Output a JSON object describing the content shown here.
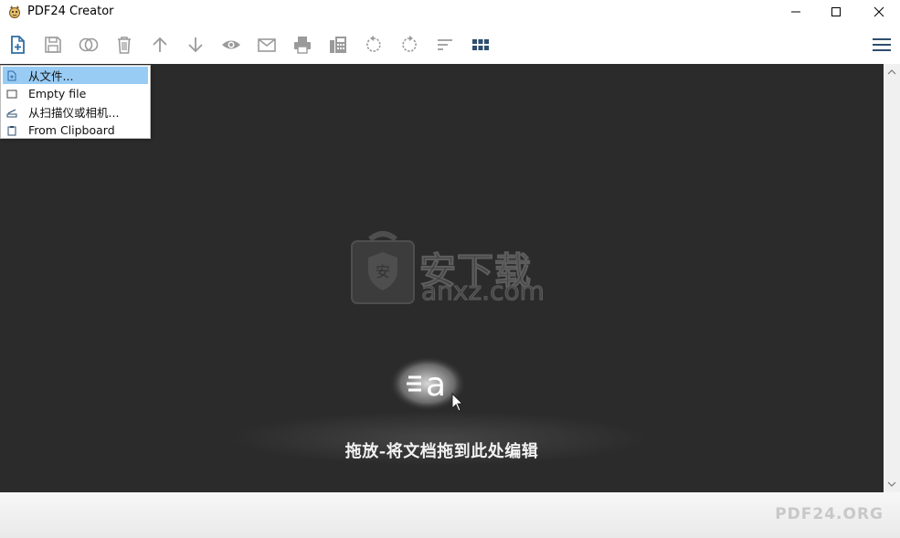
{
  "window": {
    "title": "PDF24 Creator"
  },
  "toolbar": {
    "items": [
      {
        "name": "new-file",
        "icon": "file-plus-icon"
      },
      {
        "name": "save",
        "icon": "save-icon"
      },
      {
        "name": "merge",
        "icon": "merge-circles-icon"
      },
      {
        "name": "delete",
        "icon": "trash-icon"
      },
      {
        "name": "move-up",
        "icon": "arrow-up-icon"
      },
      {
        "name": "move-down",
        "icon": "arrow-down-icon"
      },
      {
        "name": "preview",
        "icon": "eye-icon"
      },
      {
        "name": "email",
        "icon": "mail-icon"
      },
      {
        "name": "print",
        "icon": "printer-icon"
      },
      {
        "name": "fax",
        "icon": "fax-icon"
      },
      {
        "name": "rotate-left",
        "icon": "rotate-left-icon"
      },
      {
        "name": "rotate-right",
        "icon": "rotate-right-icon"
      },
      {
        "name": "sort",
        "icon": "sort-icon"
      },
      {
        "name": "grid-view",
        "icon": "grid-icon"
      }
    ],
    "menu_icon": "hamburger-icon"
  },
  "menu": {
    "items": [
      {
        "label": "从文件...",
        "icon": "file-icon",
        "active": true
      },
      {
        "label": "Empty file",
        "icon": "blank-page-icon",
        "active": false
      },
      {
        "label": "从扫描仪或相机...",
        "icon": "scanner-icon",
        "active": false
      },
      {
        "label": "From Clipboard",
        "icon": "clipboard-icon",
        "active": false
      }
    ]
  },
  "workspace": {
    "drop_hint": "拖放-将文档拖到此处编辑",
    "watermark_main": "安下载",
    "watermark_sub": "anxz.com"
  },
  "footer": {
    "brand": "PDF24.ORG"
  },
  "colors": {
    "workspace_bg": "#2b2b2b",
    "menu_highlight": "#99ccf4",
    "icon_gray": "#9a9a9a",
    "icon_blue": "#2e6da4"
  }
}
